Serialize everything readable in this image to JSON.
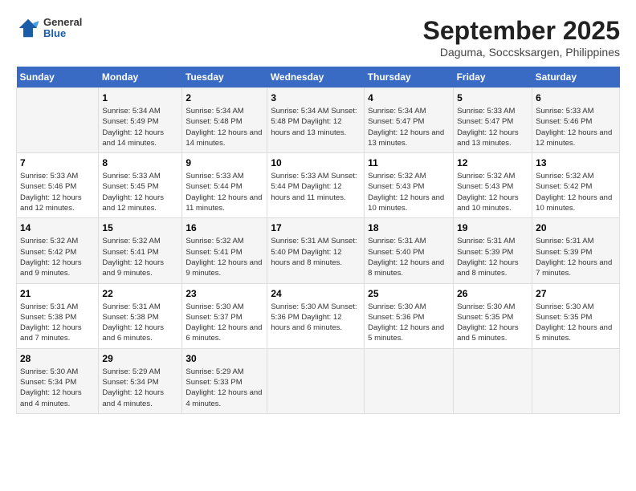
{
  "header": {
    "logo": {
      "general": "General",
      "blue": "Blue"
    },
    "title": "September 2025",
    "location": "Daguma, Soccsksargen, Philippines"
  },
  "weekdays": [
    "Sunday",
    "Monday",
    "Tuesday",
    "Wednesday",
    "Thursday",
    "Friday",
    "Saturday"
  ],
  "weeks": [
    [
      {
        "day": "",
        "info": ""
      },
      {
        "day": "1",
        "info": "Sunrise: 5:34 AM\nSunset: 5:49 PM\nDaylight: 12 hours\nand 14 minutes."
      },
      {
        "day": "2",
        "info": "Sunrise: 5:34 AM\nSunset: 5:48 PM\nDaylight: 12 hours\nand 14 minutes."
      },
      {
        "day": "3",
        "info": "Sunrise: 5:34 AM\nSunset: 5:48 PM\nDaylight: 12 hours\nand 13 minutes."
      },
      {
        "day": "4",
        "info": "Sunrise: 5:34 AM\nSunset: 5:47 PM\nDaylight: 12 hours\nand 13 minutes."
      },
      {
        "day": "5",
        "info": "Sunrise: 5:33 AM\nSunset: 5:47 PM\nDaylight: 12 hours\nand 13 minutes."
      },
      {
        "day": "6",
        "info": "Sunrise: 5:33 AM\nSunset: 5:46 PM\nDaylight: 12 hours\nand 12 minutes."
      }
    ],
    [
      {
        "day": "7",
        "info": "Sunrise: 5:33 AM\nSunset: 5:46 PM\nDaylight: 12 hours\nand 12 minutes."
      },
      {
        "day": "8",
        "info": "Sunrise: 5:33 AM\nSunset: 5:45 PM\nDaylight: 12 hours\nand 12 minutes."
      },
      {
        "day": "9",
        "info": "Sunrise: 5:33 AM\nSunset: 5:44 PM\nDaylight: 12 hours\nand 11 minutes."
      },
      {
        "day": "10",
        "info": "Sunrise: 5:33 AM\nSunset: 5:44 PM\nDaylight: 12 hours\nand 11 minutes."
      },
      {
        "day": "11",
        "info": "Sunrise: 5:32 AM\nSunset: 5:43 PM\nDaylight: 12 hours\nand 10 minutes."
      },
      {
        "day": "12",
        "info": "Sunrise: 5:32 AM\nSunset: 5:43 PM\nDaylight: 12 hours\nand 10 minutes."
      },
      {
        "day": "13",
        "info": "Sunrise: 5:32 AM\nSunset: 5:42 PM\nDaylight: 12 hours\nand 10 minutes."
      }
    ],
    [
      {
        "day": "14",
        "info": "Sunrise: 5:32 AM\nSunset: 5:42 PM\nDaylight: 12 hours\nand 9 minutes."
      },
      {
        "day": "15",
        "info": "Sunrise: 5:32 AM\nSunset: 5:41 PM\nDaylight: 12 hours\nand 9 minutes."
      },
      {
        "day": "16",
        "info": "Sunrise: 5:32 AM\nSunset: 5:41 PM\nDaylight: 12 hours\nand 9 minutes."
      },
      {
        "day": "17",
        "info": "Sunrise: 5:31 AM\nSunset: 5:40 PM\nDaylight: 12 hours\nand 8 minutes."
      },
      {
        "day": "18",
        "info": "Sunrise: 5:31 AM\nSunset: 5:40 PM\nDaylight: 12 hours\nand 8 minutes."
      },
      {
        "day": "19",
        "info": "Sunrise: 5:31 AM\nSunset: 5:39 PM\nDaylight: 12 hours\nand 8 minutes."
      },
      {
        "day": "20",
        "info": "Sunrise: 5:31 AM\nSunset: 5:39 PM\nDaylight: 12 hours\nand 7 minutes."
      }
    ],
    [
      {
        "day": "21",
        "info": "Sunrise: 5:31 AM\nSunset: 5:38 PM\nDaylight: 12 hours\nand 7 minutes."
      },
      {
        "day": "22",
        "info": "Sunrise: 5:31 AM\nSunset: 5:38 PM\nDaylight: 12 hours\nand 6 minutes."
      },
      {
        "day": "23",
        "info": "Sunrise: 5:30 AM\nSunset: 5:37 PM\nDaylight: 12 hours\nand 6 minutes."
      },
      {
        "day": "24",
        "info": "Sunrise: 5:30 AM\nSunset: 5:36 PM\nDaylight: 12 hours\nand 6 minutes."
      },
      {
        "day": "25",
        "info": "Sunrise: 5:30 AM\nSunset: 5:36 PM\nDaylight: 12 hours\nand 5 minutes."
      },
      {
        "day": "26",
        "info": "Sunrise: 5:30 AM\nSunset: 5:35 PM\nDaylight: 12 hours\nand 5 minutes."
      },
      {
        "day": "27",
        "info": "Sunrise: 5:30 AM\nSunset: 5:35 PM\nDaylight: 12 hours\nand 5 minutes."
      }
    ],
    [
      {
        "day": "28",
        "info": "Sunrise: 5:30 AM\nSunset: 5:34 PM\nDaylight: 12 hours\nand 4 minutes."
      },
      {
        "day": "29",
        "info": "Sunrise: 5:29 AM\nSunset: 5:34 PM\nDaylight: 12 hours\nand 4 minutes."
      },
      {
        "day": "30",
        "info": "Sunrise: 5:29 AM\nSunset: 5:33 PM\nDaylight: 12 hours\nand 4 minutes."
      },
      {
        "day": "",
        "info": ""
      },
      {
        "day": "",
        "info": ""
      },
      {
        "day": "",
        "info": ""
      },
      {
        "day": "",
        "info": ""
      }
    ]
  ]
}
